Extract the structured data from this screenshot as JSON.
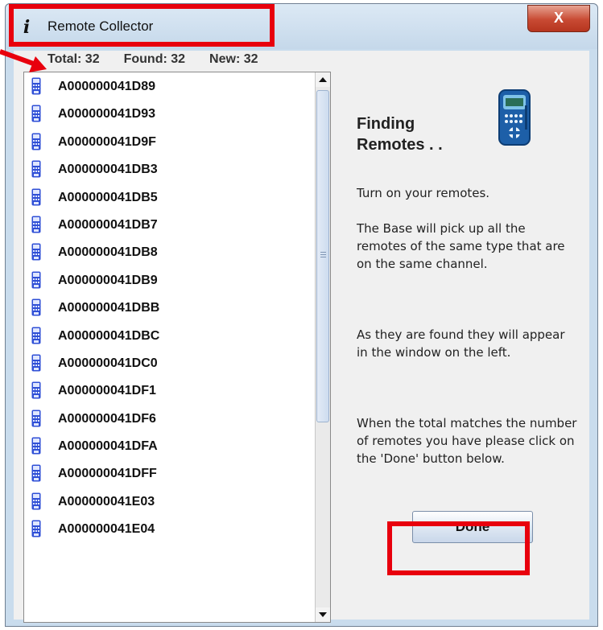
{
  "window": {
    "title": "Remote Collector",
    "title_icon": "i",
    "close_glyph": "X"
  },
  "counts": {
    "total": "Total: 32",
    "found": "Found: 32",
    "new": "New: 32"
  },
  "remotes": [
    "A000000041D89",
    "A000000041D93",
    "A000000041D9F",
    "A000000041DB3",
    "A000000041DB5",
    "A000000041DB7",
    "A000000041DB8",
    "A000000041DB9",
    "A000000041DBB",
    "A000000041DBC",
    "A000000041DC0",
    "A000000041DF1",
    "A000000041DF6",
    "A000000041DFA",
    "A000000041DFF",
    "A000000041E03",
    "A000000041E04"
  ],
  "panel": {
    "title": "Finding Remotes . .",
    "para1": "Turn on your remotes.",
    "para2": "The Base will pick up all the remotes of the same type that are on the same channel.",
    "para3": "As they are found they will appear in the window on the left.",
    "para4": "When the total matches the number of remotes you have please click on the 'Done' button below.",
    "done_label": "Done"
  },
  "colors": {
    "highlight": "#e8000d",
    "remote_icon": "#2f4fd6"
  }
}
